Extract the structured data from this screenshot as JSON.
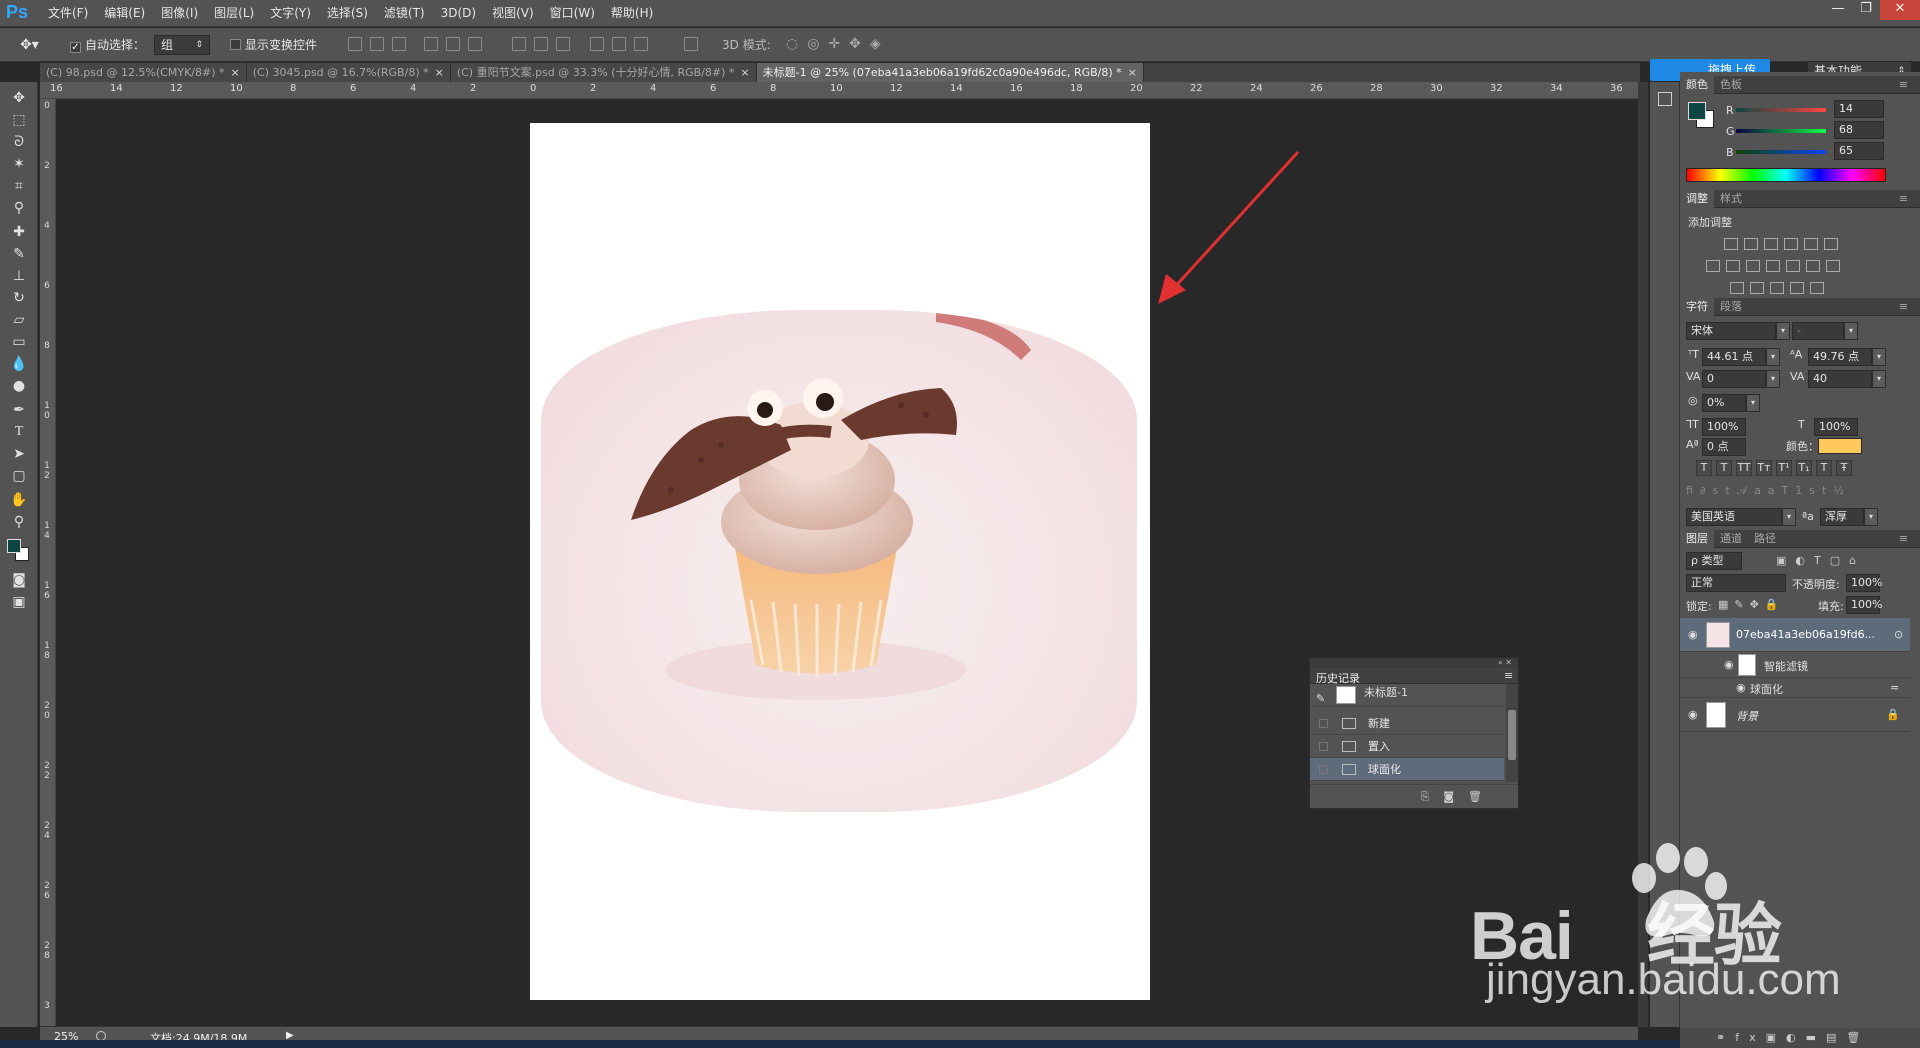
{
  "app": {
    "logo": "Ps",
    "window_buttons": [
      "—",
      "❐",
      "✕"
    ]
  },
  "menus": [
    "文件(F)",
    "编辑(E)",
    "图像(I)",
    "图层(L)",
    "文字(Y)",
    "选择(S)",
    "滤镜(T)",
    "3D(D)",
    "视图(V)",
    "窗口(W)",
    "帮助(H)"
  ],
  "options": {
    "auto_select_label": "自动选择：",
    "auto_select_value": "组",
    "show_transform_label": "显示变换控件",
    "mode_3d_label": "3D 模式:",
    "upload_label": "拖拽上传",
    "workspace": "基本功能"
  },
  "tabs": [
    {
      "label": "(C) 98.psd @ 12.5%(CMYK/8#) *",
      "close": "×"
    },
    {
      "label": "(C) 3045.psd @ 16.7%(RGB/8) *",
      "close": "×"
    },
    {
      "label": "(C) 重阳节文案.psd @ 33.3% (十分好心情, RGB/8#) *",
      "close": "×"
    },
    {
      "label": "未标题-1 @ 25% (07eba41a3eb06a19fd62c0a90e496dc, RGB/8) *",
      "close": "×"
    }
  ],
  "ruler_top": [
    "16",
    "14",
    "12",
    "10",
    "8",
    "6",
    "4",
    "2",
    "0",
    "2",
    "4",
    "6",
    "8",
    "10",
    "12",
    "14",
    "16",
    "18",
    "20",
    "22",
    "24",
    "26",
    "28",
    "30",
    "32",
    "34",
    "36"
  ],
  "ruler_left": [
    "0",
    "2",
    "4",
    "6",
    "8",
    "1 0",
    "1 2",
    "1 4",
    "1 6",
    "1 8",
    "2 0",
    "2 2",
    "2 4",
    "2 6",
    "2 8",
    "3"
  ],
  "status": {
    "zoom": "25%",
    "doc": "文档:24.9M/18.9M",
    "arrow": "▶"
  },
  "color_panel": {
    "tabs": [
      "颜色",
      "色板"
    ],
    "r_label": "R",
    "g_label": "G",
    "b_label": "B",
    "r": "14",
    "g": "68",
    "b": "65",
    "fg": "#0e4441"
  },
  "adjust_panel": {
    "tabs": [
      "调整",
      "样式"
    ],
    "title": "添加调整"
  },
  "char_panel": {
    "tabs": [
      "字符",
      "段落"
    ],
    "font": "宋体",
    "style": "-",
    "size": "44.61 点",
    "leading": "49.76 点",
    "kerning": "0",
    "tracking": "40",
    "scale_pct": "0%",
    "v_scale": "100%",
    "h_scale": "100%",
    "baseline": "0 点",
    "color_label": "颜色：",
    "color": "#ffc85a",
    "language": "美国英语",
    "aa_label": "ªa",
    "aa": "浑厚",
    "style_buttons": [
      "T",
      "T",
      "TT",
      "Tт",
      "T¹",
      "T₁",
      "T",
      "Ŧ"
    ]
  },
  "layers_panel": {
    "tabs": [
      "图层",
      "通道",
      "路径"
    ],
    "filter": "ρ 类型",
    "blend": "正常",
    "opacity_label": "不透明度:",
    "opacity": "100%",
    "lock_label": "锁定:",
    "fill_label": "填充:",
    "fill": "100%",
    "layers": [
      {
        "name": "07eba41a3eb06a19fd6..."
      },
      {
        "name": "智能滤镜"
      },
      {
        "name": "球面化"
      },
      {
        "name": "背景"
      }
    ]
  },
  "history_panel": {
    "title": "历史记录",
    "snapshot": "未标题-1",
    "items": [
      "新建",
      "置入",
      "球面化"
    ]
  },
  "watermark": {
    "brand": "Bai",
    "brand_cn": "经验",
    "url": "jingyan.baidu.com"
  }
}
